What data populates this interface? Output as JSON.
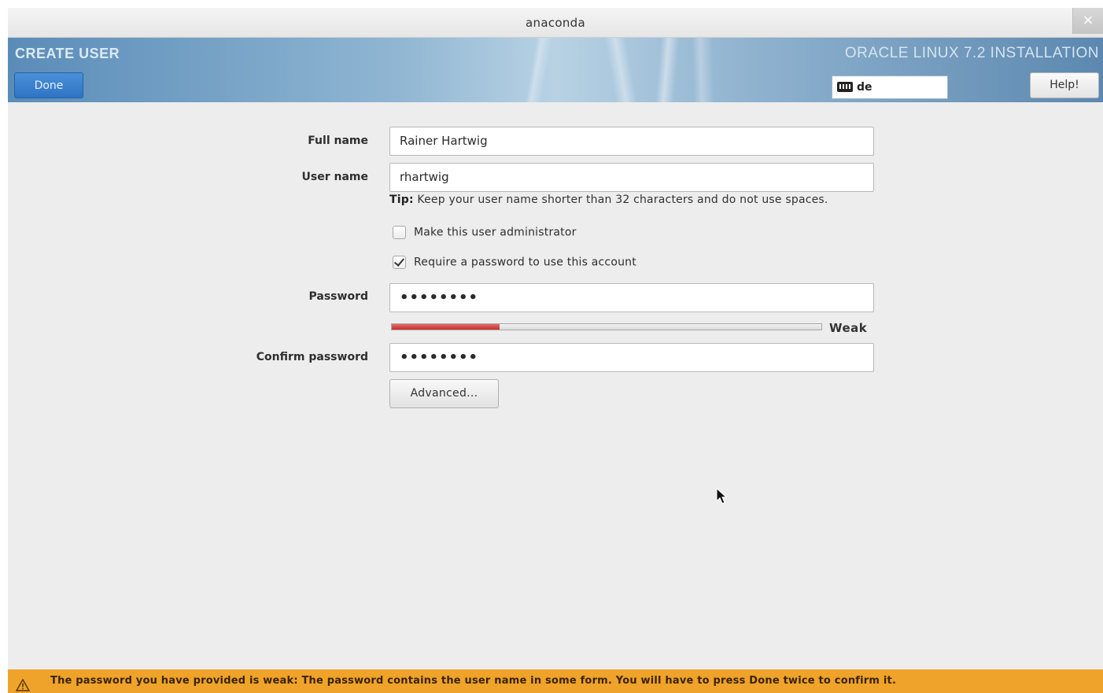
{
  "window": {
    "title": "anaconda",
    "close_glyph": "×"
  },
  "header": {
    "section_title": "CREATE USER",
    "done_label": "Done",
    "product_title": "ORACLE LINUX 7.2 INSTALLATION",
    "keyboard_layout": "de",
    "help_label": "Help!"
  },
  "form": {
    "full_name_label": "Full name",
    "full_name_value": "Rainer Hartwig",
    "user_name_label": "User name",
    "user_name_value": "rhartwig",
    "tip_prefix": "Tip:",
    "tip_text": " Keep your user name shorter than 32 characters and do not use spaces.",
    "admin_checkbox_label": "Make this user administrator",
    "admin_checked": false,
    "require_password_label": "Require a password to use this account",
    "require_password_checked": true,
    "password_label": "Password",
    "password_value": "••••••••",
    "strength_label": "Weak",
    "strength_fraction": 0.25,
    "confirm_label": "Confirm password",
    "confirm_value": "••••••••",
    "advanced_label": "Advanced..."
  },
  "status": {
    "warning_text": "The password you have provided is weak: The password contains the user name in some form. You will have to press Done twice to confirm it."
  },
  "colors": {
    "accent": "#2f74c4",
    "warning_bar": "#f0a32a",
    "strength_weak": "#c62f2f"
  }
}
